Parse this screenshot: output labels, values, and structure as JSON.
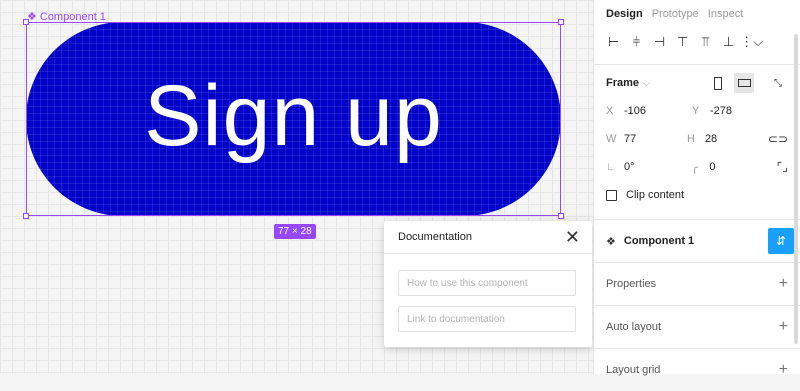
{
  "canvas": {
    "component_label": "Component 1",
    "button_text": "Sign up",
    "size_badge": "77 × 28",
    "fill_color": "#0000c8",
    "selection_color": "#9747ff"
  },
  "doc_popup": {
    "title": "Documentation",
    "usage_placeholder": "How to use this component",
    "link_placeholder": "Link to documentation"
  },
  "panel": {
    "tabs": [
      {
        "label": "Design",
        "active": true
      },
      {
        "label": "Prototype",
        "active": false
      },
      {
        "label": "Inspect",
        "active": false
      }
    ],
    "frame": {
      "title": "Frame",
      "x_label": "X",
      "x_value": "-106",
      "y_label": "Y",
      "y_value": "-278",
      "w_label": "W",
      "w_value": "77",
      "h_label": "H",
      "h_value": "28",
      "rotation": "0°",
      "radius": "0",
      "clip_content": "Clip content"
    },
    "component": {
      "name": "Component 1",
      "accent": "#18a0fb"
    },
    "sections": {
      "properties": "Properties",
      "auto_layout": "Auto layout",
      "layout_grid": "Layout grid"
    }
  }
}
